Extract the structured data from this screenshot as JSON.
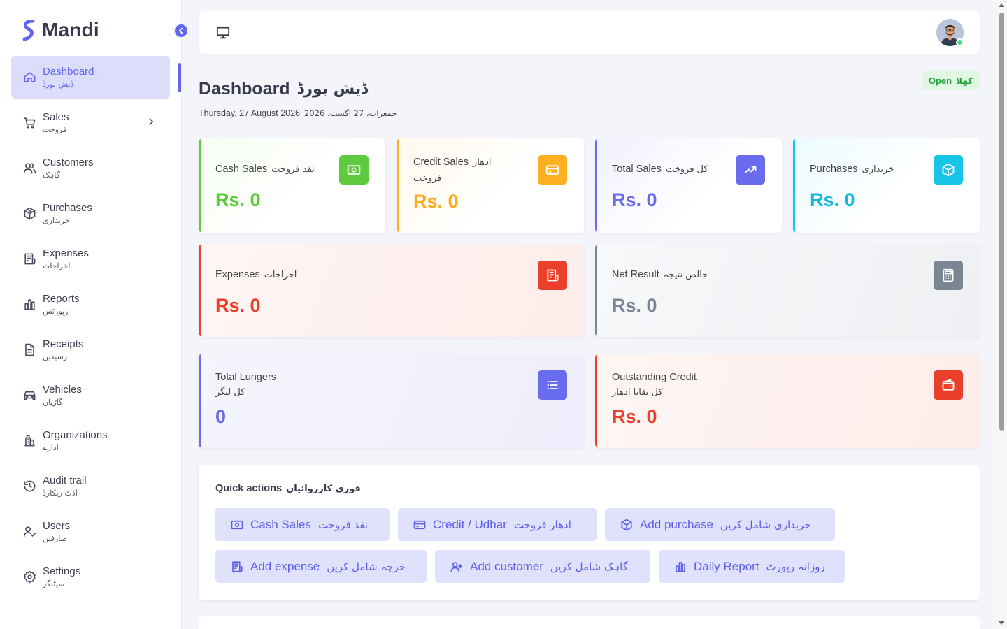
{
  "app": {
    "name": "Mandi"
  },
  "colors": {
    "accent": "#6366f1",
    "green": "#5ecb3f",
    "amber": "#ffb020",
    "indigo": "#6a6cf0",
    "cyan": "#18c5e8",
    "red": "#ea3f2a",
    "slate": "#7b8594"
  },
  "sidebar": {
    "items": [
      {
        "label": "Dashboard",
        "sub": "ڈیش بورڈ",
        "icon": "home-icon",
        "active": true
      },
      {
        "label": "Sales",
        "sub": "فروخت",
        "icon": "cart-icon",
        "has_children": true
      },
      {
        "label": "Customers",
        "sub": "گاہک",
        "icon": "users-icon"
      },
      {
        "label": "Purchases",
        "sub": "خریداری",
        "icon": "box-icon"
      },
      {
        "label": "Expenses",
        "sub": "اخراجات",
        "icon": "receipt-icon"
      },
      {
        "label": "Reports",
        "sub": "رپورٹس",
        "icon": "bar-chart-icon"
      },
      {
        "label": "Receipts",
        "sub": "رسیدیں",
        "icon": "file-icon"
      },
      {
        "label": "Vehicles",
        "sub": "گاڑیاں",
        "icon": "car-icon"
      },
      {
        "label": "Organizations",
        "sub": "ادارے",
        "icon": "building-icon"
      },
      {
        "label": "Audit trail",
        "sub": "آڈٹ ریکارڈ",
        "icon": "history-icon"
      },
      {
        "label": "Users",
        "sub": "صارفین",
        "icon": "user-check-icon"
      },
      {
        "label": "Settings",
        "sub": "سیٹنگز",
        "icon": "gear-icon"
      }
    ]
  },
  "header": {
    "title": "Dashboard",
    "title_ur": "ڈیش بورڈ",
    "date": "Thursday, 27 August 2026",
    "date_ur": "جمعرات، 27 اگست، 2026",
    "status": "Open",
    "status_ur": "کھلا"
  },
  "cards": {
    "cash_sales": {
      "label": "Cash Sales",
      "label_ur": "نقد فروخت",
      "value": "Rs. 0",
      "icon": "cash-icon"
    },
    "credit_sales": {
      "label": "Credit Sales",
      "label_ur": "ادھار فروخت",
      "value": "Rs. 0",
      "icon": "credit-card-icon"
    },
    "total_sales": {
      "label": "Total Sales",
      "label_ur": "کل فروخت",
      "value": "Rs. 0",
      "icon": "trending-up-icon"
    },
    "purchases": {
      "label": "Purchases",
      "label_ur": "خریداری",
      "value": "Rs. 0",
      "icon": "box-icon"
    },
    "expenses": {
      "label": "Expenses",
      "label_ur": "اخراجات",
      "value": "Rs. 0",
      "icon": "receipt-icon"
    },
    "net_result": {
      "label": "Net Result",
      "label_ur": "خالص نتیجہ",
      "value": "Rs. 0",
      "icon": "calculator-icon"
    },
    "total_lungers": {
      "label": "Total Lungers",
      "label_ur": "کل لنگر",
      "value": "0",
      "icon": "list-icon"
    },
    "outstanding_credit": {
      "label": "Outstanding Credit",
      "label_ur": "کل بقایا ادھار",
      "value": "Rs. 0",
      "icon": "wallet-icon"
    }
  },
  "quick_actions": {
    "title": "Quick actions",
    "title_ur": "فوری کارروائیاں",
    "buttons": [
      {
        "label": "Cash Sales",
        "label_ur": "نقد فروخت",
        "icon": "cash-icon"
      },
      {
        "label": "Credit / Udhar",
        "label_ur": "ادھار فروخت",
        "icon": "credit-card-icon"
      },
      {
        "label": "Add purchase",
        "label_ur": "خریداری شامل کریں",
        "icon": "box-icon"
      },
      {
        "label": "Add expense",
        "label_ur": "خرچہ شامل کریں",
        "icon": "receipt-icon"
      },
      {
        "label": "Add customer",
        "label_ur": "گاہک شامل کریں",
        "icon": "user-plus-icon"
      },
      {
        "label": "Daily Report",
        "label_ur": "روزانہ رپورٹ",
        "icon": "bar-chart-icon"
      }
    ]
  }
}
